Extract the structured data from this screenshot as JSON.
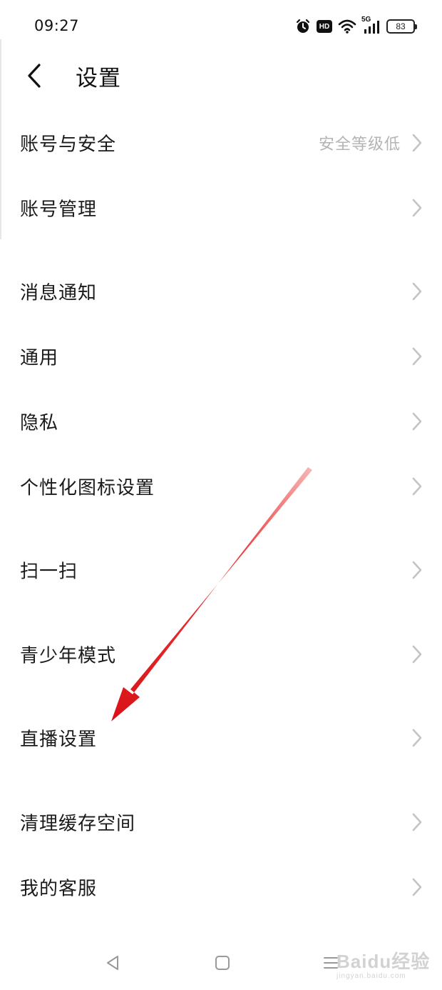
{
  "status_bar": {
    "time": "09:27",
    "network_label": "5G",
    "hd_label": "HD",
    "battery_level": "83"
  },
  "header": {
    "title": "设置"
  },
  "settings": [
    {
      "label": "账号与安全",
      "value": "安全等级低"
    },
    {
      "label": "账号管理"
    },
    {
      "label": "消息通知"
    },
    {
      "label": "通用"
    },
    {
      "label": "隐私"
    },
    {
      "label": "个性化图标设置"
    },
    {
      "label": "扫一扫"
    },
    {
      "label": "青少年模式"
    },
    {
      "label": "直播设置"
    },
    {
      "label": "清理缓存空间"
    },
    {
      "label": "我的客服"
    }
  ],
  "watermark": {
    "main": "Baidu经验",
    "sub": "jingyan.baidu.com"
  },
  "colors": {
    "annotation_arrow": "#e8161c",
    "chevron": "#c4c4c4",
    "secondary_text": "#b4b4b4"
  }
}
